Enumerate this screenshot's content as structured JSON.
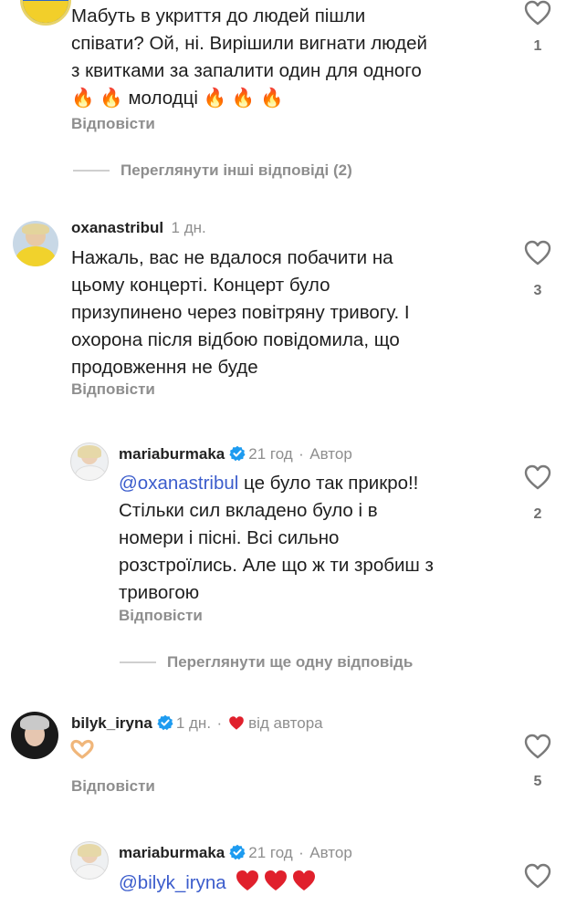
{
  "comment1": {
    "lines": [
      "Мабуть в укриття до людей пішли",
      "співати? Ой, ні. Вирішили вигнати людей",
      "з квитками за запалити один для одного"
    ],
    "line4_prefix_emoji": "🔥 🔥",
    "line4_word": "молодці",
    "line4_suffix_emoji": "🔥 🔥 🔥",
    "reply_label": "Відповісти",
    "likes": "1",
    "view_replies": "Переглянути інші відповіді (2)"
  },
  "comment2": {
    "username": "oxanastribul",
    "time": "1 дн.",
    "lines": [
      "Нажаль, вас не вдалося побачити на",
      "цьому концерті. Концерт було",
      "призупинено через повітряну тривогу. І",
      "охорона після відбою повідомила, що",
      "продовження не буде"
    ],
    "reply_label": "Відповісти",
    "likes": "3"
  },
  "reply1": {
    "username": "mariaburmaka",
    "time": "21 год",
    "sep": "·",
    "author": "Автор",
    "mention": "@oxanastribul",
    "line1_rest": " це було так прикро!!",
    "lines": [
      "Стільки сил вкладено було і в",
      "номери і пісні. Всі сильно",
      "розстроїлись. Але що ж ти зробиш з",
      "тривогою"
    ],
    "reply_label": "Відповісти",
    "likes": "2",
    "view_more": "Переглянути ще одну відповідь"
  },
  "comment3": {
    "username": "bilyk_iryna",
    "time": "1 дн.",
    "sep": "·",
    "from_author": "від автора",
    "body_emoji": "🫶",
    "reply_label": "Відповісти",
    "likes": "5"
  },
  "reply2": {
    "username": "mariaburmaka",
    "time": "21 год",
    "sep": "·",
    "author": "Автор",
    "mention": "@bilyk_iryna",
    "hearts": "❤️ ❤️ ❤️"
  },
  "colors": {
    "mention": "#3b5ccc",
    "verified": "#1d9bf0",
    "muted": "#8e8e8e",
    "heart_red": "#e0202c"
  }
}
